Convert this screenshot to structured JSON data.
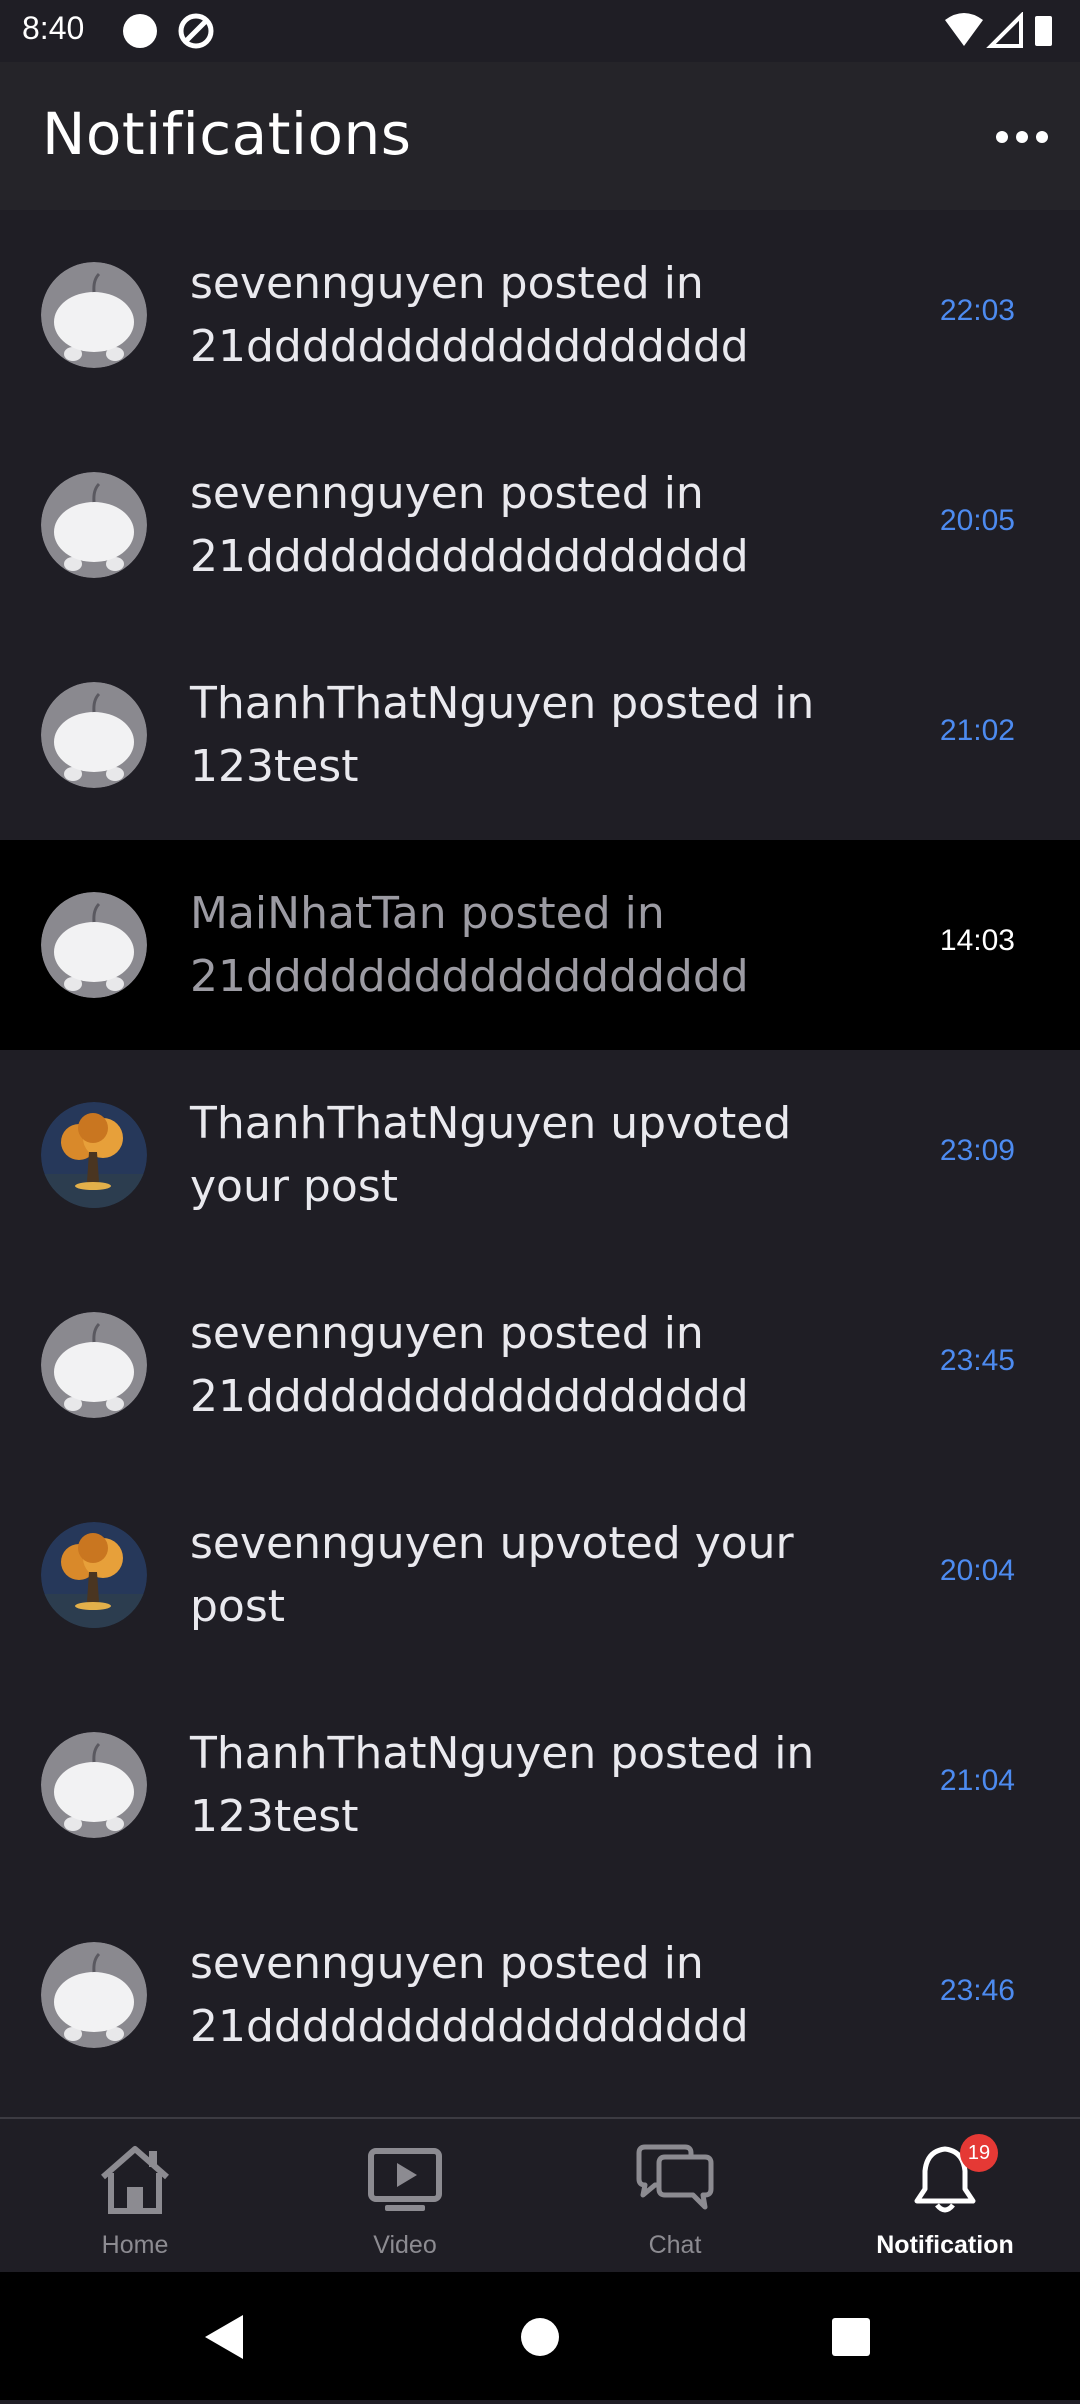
{
  "status_bar": {
    "time": "8:40"
  },
  "header": {
    "title": "Notifications"
  },
  "notifications": [
    {
      "text": "sevennguyen posted in 21dddddddddddddddddd",
      "time": "22:03",
      "avatar": "default",
      "read": false
    },
    {
      "text": "sevennguyen posted in 21dddddddddddddddddd",
      "time": "20:05",
      "avatar": "default",
      "read": false
    },
    {
      "text": "ThanhThatNguyen posted in 123test",
      "time": "21:02",
      "avatar": "default",
      "read": false
    },
    {
      "text": "MaiNhatTan posted in 21dddddddddddddddddd",
      "time": "14:03",
      "avatar": "default",
      "read": true
    },
    {
      "text": "ThanhThatNguyen upvoted your post",
      "time": "23:09",
      "avatar": "tree",
      "read": false
    },
    {
      "text": "sevennguyen posted in 21dddddddddddddddddd",
      "time": "23:45",
      "avatar": "default",
      "read": false
    },
    {
      "text": "sevennguyen upvoted your post",
      "time": "20:04",
      "avatar": "tree",
      "read": false
    },
    {
      "text": "ThanhThatNguyen posted in 123test",
      "time": "21:04",
      "avatar": "default",
      "read": false
    },
    {
      "text": "sevennguyen posted in 21dddddddddddddddddd",
      "time": "23:46",
      "avatar": "default",
      "read": false
    }
  ],
  "bottom_nav": {
    "home": "Home",
    "video": "Video",
    "chat": "Chat",
    "notification": "Notification",
    "badge": "19"
  },
  "colors": {
    "accent_time": "#4d8bf0",
    "badge": "#e53935",
    "background": "#1f1e25"
  }
}
